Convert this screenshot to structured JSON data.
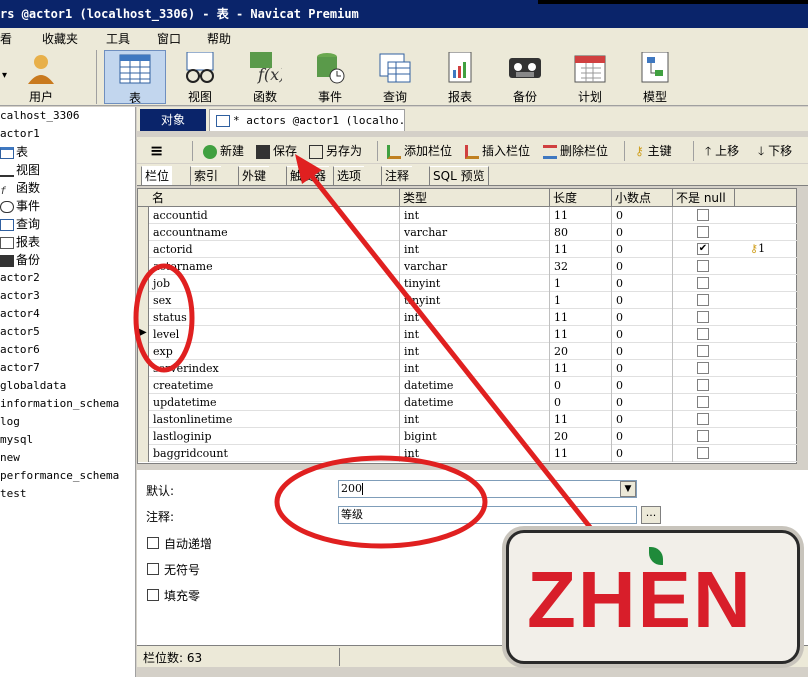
{
  "window": {
    "title": "rs @actor1 (localhost_3306) - 表 - Navicat Premium"
  },
  "menu": {
    "items": [
      "看",
      "收藏夹",
      "工具",
      "窗口",
      "帮助"
    ]
  },
  "toolbar": {
    "items": [
      {
        "label": "用户",
        "icon": "user-icon"
      },
      {
        "label": "表",
        "icon": "table-icon",
        "active": true
      },
      {
        "label": "视图",
        "icon": "view-glasses-icon"
      },
      {
        "label": "函数",
        "icon": "function-icon"
      },
      {
        "label": "事件",
        "icon": "event-clock-icon"
      },
      {
        "label": "查询",
        "icon": "query-icon"
      },
      {
        "label": "报表",
        "icon": "report-icon"
      },
      {
        "label": "备份",
        "icon": "backup-tape-icon"
      },
      {
        "label": "计划",
        "icon": "schedule-calendar-icon"
      },
      {
        "label": "模型",
        "icon": "model-icon"
      }
    ]
  },
  "sidebar": {
    "items": [
      {
        "label": "calhost_3306",
        "icon": ""
      },
      {
        "label": "actor1",
        "icon": ""
      },
      {
        "label": "表",
        "icon": "table-icon",
        "selected": true
      },
      {
        "label": "视图",
        "icon": "view-glasses-icon"
      },
      {
        "label": "函数",
        "icon": "function-icon"
      },
      {
        "label": "事件",
        "icon": "event-clock-icon"
      },
      {
        "label": "查询",
        "icon": "query-icon"
      },
      {
        "label": "报表",
        "icon": "report-icon"
      },
      {
        "label": "备份",
        "icon": "backup-tape-icon"
      },
      {
        "label": "actor2"
      },
      {
        "label": "actor3"
      },
      {
        "label": "actor4"
      },
      {
        "label": "actor5"
      },
      {
        "label": "actor6"
      },
      {
        "label": "actor7"
      },
      {
        "label": "globaldata"
      },
      {
        "label": "information_schema"
      },
      {
        "label": "log"
      },
      {
        "label": "mysql"
      },
      {
        "label": "new"
      },
      {
        "label": "performance_schema"
      },
      {
        "label": "test"
      }
    ]
  },
  "doc_tabs": {
    "objects": "对象",
    "current": "* actors @actor1 (localho..."
  },
  "designer_toolbar": {
    "menu": "≡",
    "new": "新建",
    "save": "保存",
    "save_as": "另存为",
    "add_field": "添加栏位",
    "insert_field": "插入栏位",
    "delete_field": "删除栏位",
    "primary_key": "主键",
    "move_up": "上移",
    "move_down": "下移"
  },
  "designer_tabs": [
    "栏位",
    "索引",
    "外键",
    "触发器",
    "选项",
    "注释",
    "SQL 预览"
  ],
  "grid": {
    "columns": [
      "名",
      "类型",
      "长度",
      "小数点",
      "不是 null",
      ""
    ],
    "rows": [
      {
        "name": "accountid",
        "type": "int",
        "length": "11",
        "decimals": "0",
        "not_null": false,
        "key": ""
      },
      {
        "name": "accountname",
        "type": "varchar",
        "length": "80",
        "decimals": "0",
        "not_null": false,
        "key": ""
      },
      {
        "name": "actorid",
        "type": "int",
        "length": "11",
        "decimals": "0",
        "not_null": true,
        "key": "1"
      },
      {
        "name": "actorname",
        "type": "varchar",
        "length": "32",
        "decimals": "0",
        "not_null": false,
        "key": ""
      },
      {
        "name": "job",
        "type": "tinyint",
        "length": "1",
        "decimals": "0",
        "not_null": false,
        "key": ""
      },
      {
        "name": "sex",
        "type": "tinyint",
        "length": "1",
        "decimals": "0",
        "not_null": false,
        "key": ""
      },
      {
        "name": "status",
        "type": "int",
        "length": "11",
        "decimals": "0",
        "not_null": false,
        "key": ""
      },
      {
        "name": "level",
        "type": "int",
        "length": "11",
        "decimals": "0",
        "not_null": false,
        "key": "",
        "current": true
      },
      {
        "name": "exp",
        "type": "int",
        "length": "20",
        "decimals": "0",
        "not_null": false,
        "key": ""
      },
      {
        "name": "serverindex",
        "type": "int",
        "length": "11",
        "decimals": "0",
        "not_null": false,
        "key": ""
      },
      {
        "name": "createtime",
        "type": "datetime",
        "length": "0",
        "decimals": "0",
        "not_null": false,
        "key": ""
      },
      {
        "name": "updatetime",
        "type": "datetime",
        "length": "0",
        "decimals": "0",
        "not_null": false,
        "key": ""
      },
      {
        "name": "lastonlinetime",
        "type": "int",
        "length": "11",
        "decimals": "0",
        "not_null": false,
        "key": ""
      },
      {
        "name": "lastloginip",
        "type": "bigint",
        "length": "20",
        "decimals": "0",
        "not_null": false,
        "key": ""
      },
      {
        "name": "baggridcount",
        "type": "int",
        "length": "11",
        "decimals": "0",
        "not_null": false,
        "key": ""
      }
    ]
  },
  "properties": {
    "default_label": "默认:",
    "default_value": "200",
    "comment_label": "注释:",
    "comment_value": "等级",
    "auto_increment": "自动递增",
    "unsigned": "无符号",
    "zerofill": "填充零"
  },
  "status": {
    "field_count": "栏位数: 63"
  },
  "watermark": {
    "text": "ZHEN"
  },
  "colors": {
    "title_bar": "#0a246a",
    "annotation": "#e02020",
    "logo_text": "#d81e2a"
  }
}
